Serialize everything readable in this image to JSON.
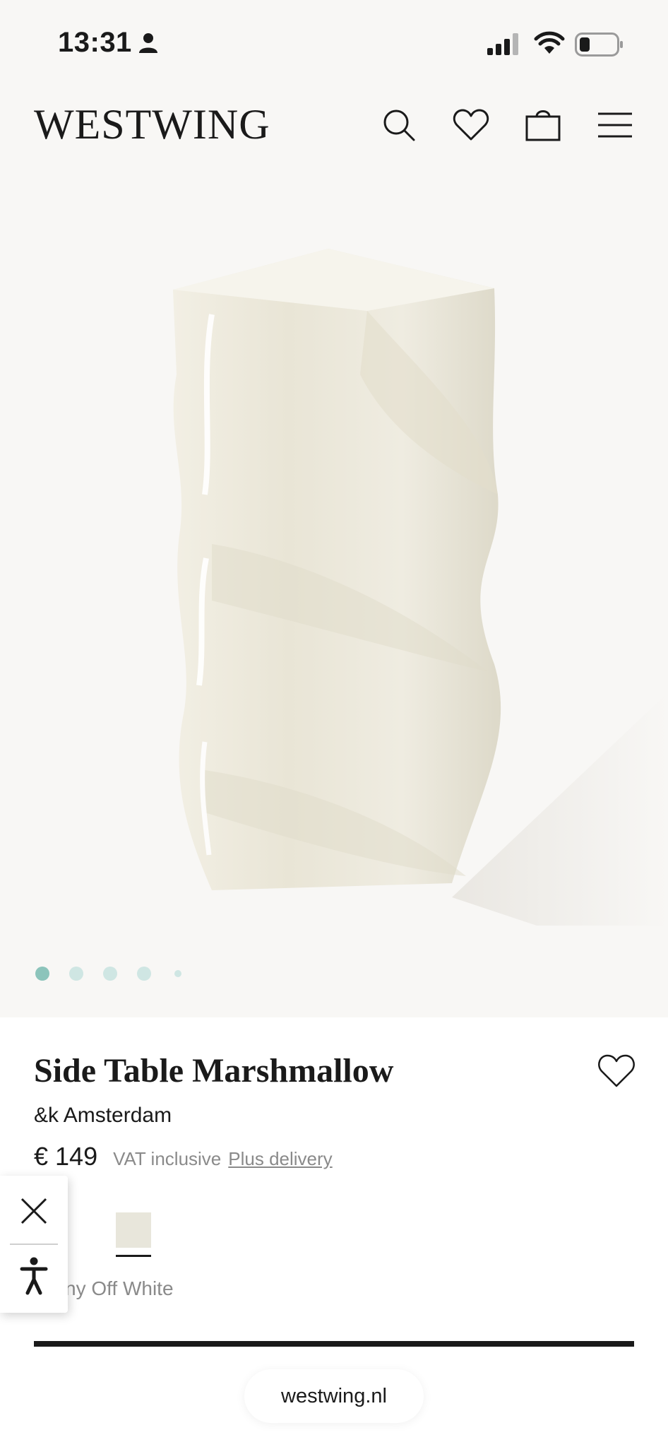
{
  "status_bar": {
    "time": "13:31"
  },
  "header": {
    "logo": "WESTWING",
    "icons": [
      "search-icon",
      "heart-icon",
      "bag-icon",
      "menu-icon"
    ]
  },
  "gallery": {
    "image": "side-table-marshmallow",
    "slide_count": 5,
    "active_slide": 1
  },
  "product": {
    "title": "Side Table Marshmallow",
    "brand": "&k Amsterdam",
    "price": "€ 149",
    "vat_text": "VAT inclusive",
    "delivery_link": "Plus delivery",
    "color_swatch": "#e8e6db",
    "color_name_visible": "ny Off White"
  },
  "accessibility": {
    "icons": [
      "close-icon",
      "accessibility-icon"
    ]
  },
  "browser": {
    "url": "westwing.nl"
  },
  "colors": {
    "background_top": "#f8f7f5",
    "dot_active": "#8cc4bb",
    "dot_inactive": "#cfe6e3",
    "text_primary": "#1a1a1a",
    "text_secondary": "#8a8a8a"
  }
}
